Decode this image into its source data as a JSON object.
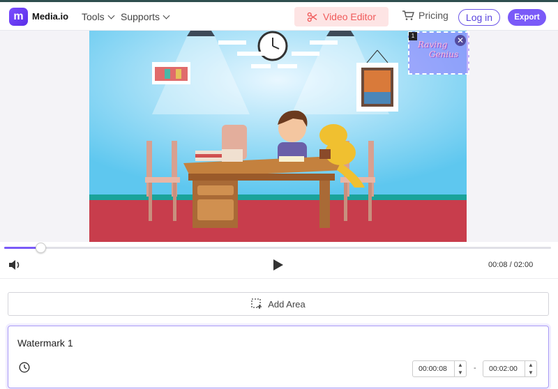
{
  "header": {
    "logo_letter": "m",
    "brand": "Media.io",
    "nav_tools": "Tools",
    "nav_supports": "Supports",
    "video_editor": "Video Editor",
    "pricing": "Pricing",
    "login": "Log in",
    "export": "Export"
  },
  "watermark_overlay": {
    "index": "1",
    "text_line1": "Raving",
    "text_line2": "Genius",
    "close_symbol": "✕"
  },
  "player": {
    "progress": 0.0667,
    "time": "00:08 / 02:00"
  },
  "add_area": {
    "label": "Add Area"
  },
  "watermark_item": {
    "title": "Watermark 1",
    "start": "00:00:08",
    "end": "00:02:00",
    "separator": "-"
  },
  "colors": {
    "accent": "#7a5af8",
    "video_editor_bg": "#fde4e4",
    "video_editor_text": "#f05a5a"
  },
  "icons": [
    "logo-icon",
    "chevron-down-icon",
    "scissors-icon",
    "cart-icon",
    "volume-icon",
    "play-icon",
    "add-area-icon",
    "clock-icon",
    "spin-up-icon",
    "spin-down-icon",
    "close-icon"
  ]
}
